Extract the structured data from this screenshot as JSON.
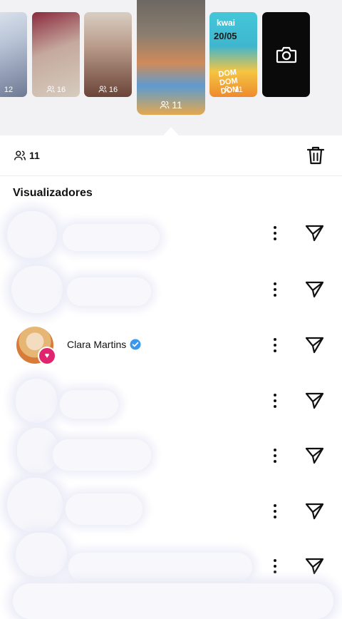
{
  "stories": [
    {
      "views": "12"
    },
    {
      "views": "16"
    },
    {
      "views": "16"
    },
    {
      "views": "11",
      "selected": true
    },
    {
      "views": "11",
      "overlay_text": {
        "top": "kwai",
        "date": "20/05",
        "dom": "DOM DOM DOM"
      }
    },
    {
      "type": "camera",
      "icon": "camera-icon"
    }
  ],
  "summary": {
    "viewer_count": "11",
    "icon": "viewers-icon",
    "delete_icon": "trash-icon"
  },
  "section": {
    "title": "Visualizadores"
  },
  "viewers": [
    {
      "name": "",
      "blurred": true
    },
    {
      "name": "",
      "blurred": true
    },
    {
      "name": "Clara Martins",
      "verified": true,
      "liked": true
    },
    {
      "name": "",
      "blurred": true
    },
    {
      "name": "",
      "blurred": true
    },
    {
      "name": "",
      "blurred": true
    },
    {
      "name": "",
      "blurred": true
    }
  ],
  "colors": {
    "accent_like": "#e0256e",
    "verified_blue": "#3897f0",
    "text": "#111111"
  }
}
